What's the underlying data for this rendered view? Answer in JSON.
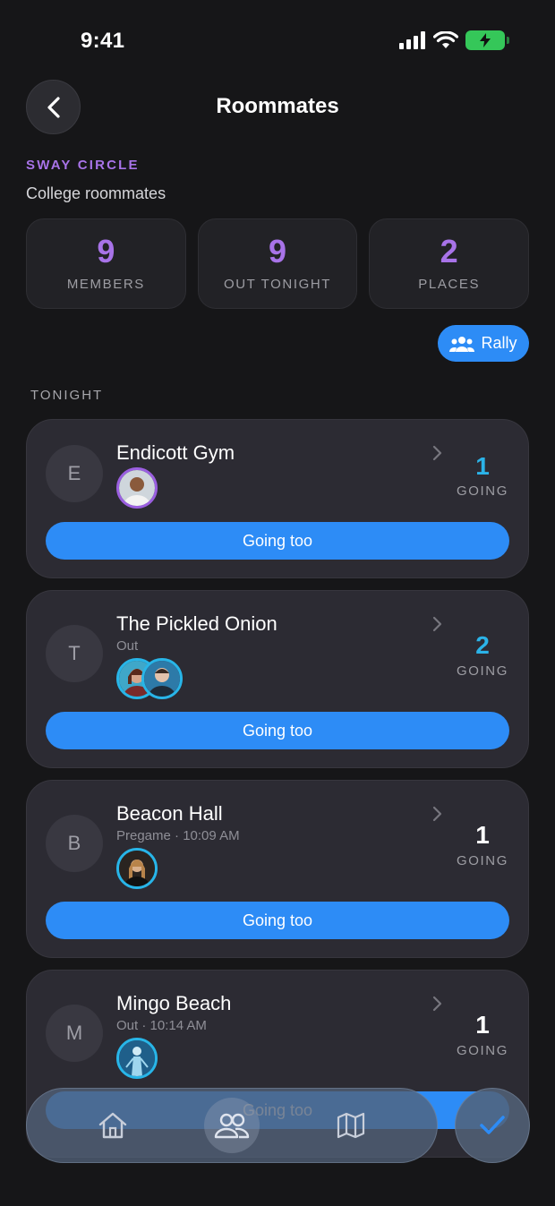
{
  "status": {
    "time": "9:41"
  },
  "header": {
    "title": "Roommates"
  },
  "circle": {
    "label": "SWAY CIRCLE",
    "name": "College roommates"
  },
  "stats": [
    {
      "value": "9",
      "label": "MEMBERS"
    },
    {
      "value": "9",
      "label": "OUT TONIGHT"
    },
    {
      "value": "2",
      "label": "PLACES"
    }
  ],
  "rally": {
    "label": "Rally"
  },
  "section": {
    "title": "TONIGHT"
  },
  "places": [
    {
      "initial": "E",
      "name": "Endicott Gym",
      "subtitle": "",
      "going_count": "1",
      "going_label": "GOING",
      "button": "Going too",
      "attendee_icons": [
        "avatar-man"
      ]
    },
    {
      "initial": "T",
      "name": "The Pickled Onion",
      "subtitle": "Out",
      "going_count": "2",
      "going_label": "GOING",
      "button": "Going too",
      "attendee_icons": [
        "avatar-woman",
        "avatar-man"
      ]
    },
    {
      "initial": "B",
      "name": "Beacon Hall",
      "subtitle": "Pregame · 10:09 AM",
      "going_count": "1",
      "going_label": "GOING",
      "button": "Going too",
      "attendee_icons": [
        "avatar-woman"
      ]
    },
    {
      "initial": "M",
      "name": "Mingo Beach",
      "subtitle": "Out · 10:14 AM",
      "going_count": "1",
      "going_label": "GOING",
      "button": "Going too",
      "attendee_icons": [
        "avatar-figure"
      ]
    }
  ],
  "nav": {
    "tabs": [
      "home-icon",
      "people-icon",
      "map-icon"
    ],
    "fab_icon": "check-icon"
  },
  "colors": {
    "accent": "#2d8cf6",
    "purple": "#a873e8",
    "cyan": "#2bb3e8",
    "background": "#161618"
  }
}
